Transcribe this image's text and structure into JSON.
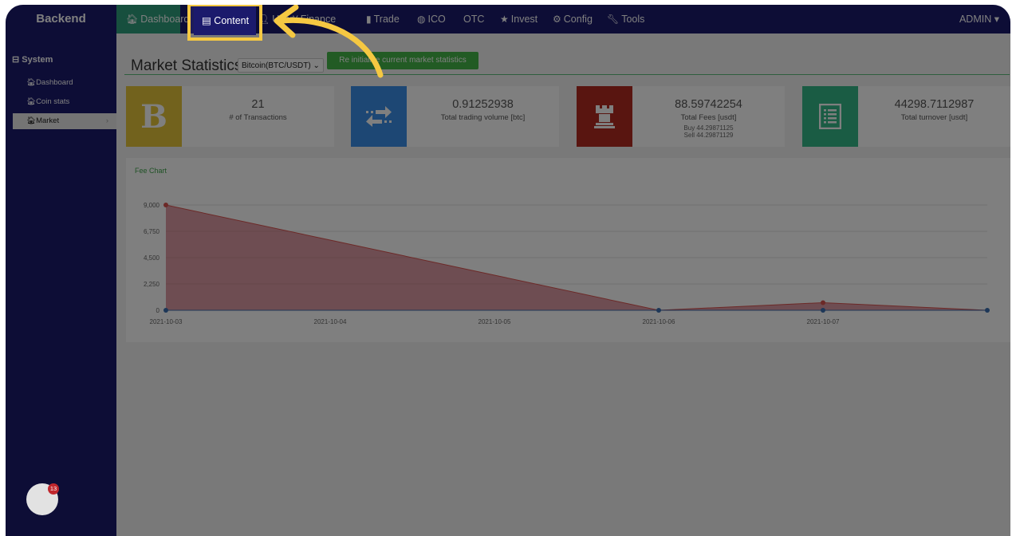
{
  "brand": "Backend",
  "nav": {
    "dashboard": "Dashboard",
    "content": "Content",
    "user": "User",
    "finance": "Finance",
    "trade": "Trade",
    "ico": "ICO",
    "otc": "OTC",
    "invest": "Invest",
    "config": "Config",
    "tools": "Tools",
    "admin": "ADMIN ▾"
  },
  "sidebar": {
    "section": "System",
    "items": [
      {
        "label": "Dashboard"
      },
      {
        "label": "Coin stats"
      },
      {
        "label": "Market"
      }
    ]
  },
  "page": {
    "title": "Market Statistics",
    "coin_select": "Bitcoin(BTC/USDT) ⌄",
    "reinit_button": "Re initialize current market statistics"
  },
  "stats": [
    {
      "value": "21",
      "label": "# of Transactions",
      "icon": "bitcoin-icon",
      "color": "#e4c53b"
    },
    {
      "value": "0.91252938",
      "label": "Total trading volume [btc]",
      "icon": "exchange-arrows-icon",
      "color": "#3a8ee8"
    },
    {
      "value": "88.59742254",
      "label": "Total Fees [usdt]",
      "buy": "Buy 44.29871125",
      "sell": "Sell 44.29871129",
      "icon": "rook-icon",
      "color": "#b32a20"
    },
    {
      "value": "44298.7112987",
      "label": "Total turnover [usdt]",
      "icon": "list-document-icon",
      "color": "#34b889"
    }
  ],
  "chart_data": {
    "type": "area",
    "title": "Fee Chart",
    "categories": [
      "2021-10-03",
      "2021-10-04",
      "2021-10-05",
      "2021-10-06",
      "2021-10-07",
      "2021-10-08"
    ],
    "series": [
      {
        "name": "",
        "color": "#d9534f",
        "values": [
          9000,
          6000,
          3000,
          0,
          650,
          0
        ]
      },
      {
        "name": "",
        "color": "#3a6fb0",
        "values": [
          0,
          0,
          0,
          0,
          0,
          0
        ]
      }
    ],
    "x_tick_labels": [
      "2021-10-03",
      "2021-10-04",
      "2021-10-05",
      "2021-10-06",
      "2021-10-07"
    ],
    "y_ticks": [
      "0",
      "2,250",
      "4,500",
      "6,750",
      "9,000"
    ],
    "ylim": [
      0,
      9000
    ],
    "grid": true
  },
  "notification_count": "13",
  "colors": {
    "topbar": "#1b1a6c",
    "highlight": "#f5c842",
    "accent_green": "#45b649"
  }
}
